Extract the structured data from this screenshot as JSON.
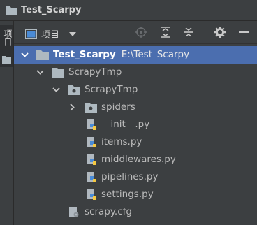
{
  "window": {
    "title": "Test_Scarpy"
  },
  "side_panel": {
    "tab_label": "项目"
  },
  "toolbar": {
    "view_label": "项目",
    "buttons": [
      "locate-icon",
      "expand-all-icon",
      "collapse-all-icon",
      "gear-icon",
      "minimize-icon"
    ]
  },
  "tree": {
    "root": {
      "name": "Test_Scarpy",
      "path": "E:\\Test_Scarpy"
    },
    "items": [
      {
        "name": "ScrapyTmp"
      },
      {
        "name": "ScrapyTmp"
      },
      {
        "name": "spiders"
      },
      {
        "name": "__init__.py"
      },
      {
        "name": "items.py"
      },
      {
        "name": "middlewares.py"
      },
      {
        "name": "pipelines.py"
      },
      {
        "name": "settings.py"
      },
      {
        "name": "scrapy.cfg"
      }
    ]
  },
  "colors": {
    "background": "#3c3f41",
    "selection": "#4b6eaf",
    "folder": "#aeb9c0",
    "python_blue": "#4a8bd6",
    "python_yellow": "#f4c842"
  }
}
